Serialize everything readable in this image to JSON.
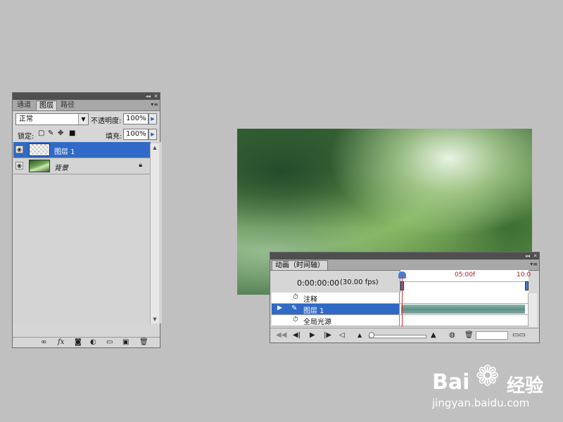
{
  "layers_panel": {
    "tabs": [
      {
        "label": "通道",
        "active": false
      },
      {
        "label": "图层",
        "active": true
      },
      {
        "label": "路径",
        "active": false
      }
    ],
    "blend_mode": "正常",
    "opacity_label": "不透明度:",
    "opacity_value": "100%",
    "lock_label": "锁定:",
    "fill_label": "填充:",
    "fill_value": "100%",
    "layers": [
      {
        "name": "图层 1",
        "selected": true,
        "thumbnail": "transparent"
      },
      {
        "name": "背景",
        "selected": false,
        "thumbnail": "forest-photo",
        "locked": true
      }
    ],
    "bottom_icons": [
      "link-icon",
      "fx-icon",
      "mask-icon",
      "adjustment-icon",
      "group-folder-icon",
      "new-layer-icon",
      "trash-icon"
    ],
    "fx_label": "fx"
  },
  "timeline_panel": {
    "title": "动画（时间轴）",
    "current_time": "0:00:00:00",
    "fps": "(30.00 fps)",
    "ruler_labels": [
      "05:00f",
      "10:0"
    ],
    "rows": [
      {
        "name": "注释",
        "type": "comments",
        "selected": false
      },
      {
        "name": "图层 1",
        "type": "layer",
        "selected": true
      },
      {
        "name": "全局光源",
        "type": "global-light",
        "selected": false
      }
    ],
    "accent_color": "#3169c6",
    "playhead_color": "#d23030"
  },
  "watermark": {
    "brand_left": "Bai",
    "brand_right": "经验",
    "url": "jingyan.baidu.com"
  }
}
